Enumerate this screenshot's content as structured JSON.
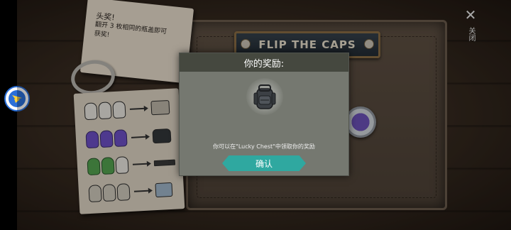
{
  "game": {
    "board_title": "FLIP THE CAPS",
    "note": {
      "heading": "头奖!",
      "body": "翻开 3 枚相同的瓶盖即可获奖!"
    },
    "legend": [
      {
        "tier": "plain",
        "reward_icon": "gift-box-icon"
      },
      {
        "tier": "purple",
        "reward_icon": "backpack-icon"
      },
      {
        "tier": "green",
        "reward_icon": "rifle-icon"
      },
      {
        "tier": "mixed",
        "reward_icon": "gift-pack-icon"
      }
    ]
  },
  "close": {
    "label": "关闭"
  },
  "dialog": {
    "title": "你的奖励:",
    "reward_icon": "backpack-icon",
    "message": "你可以在\"Lucky Chest\"中领取你的奖励",
    "confirm_label": "确认"
  },
  "colors": {
    "confirm_button": "#2fa8a0",
    "dialog_header": "#45483f",
    "dialog_body": "#757870",
    "float_button": "#2a6fd8"
  }
}
